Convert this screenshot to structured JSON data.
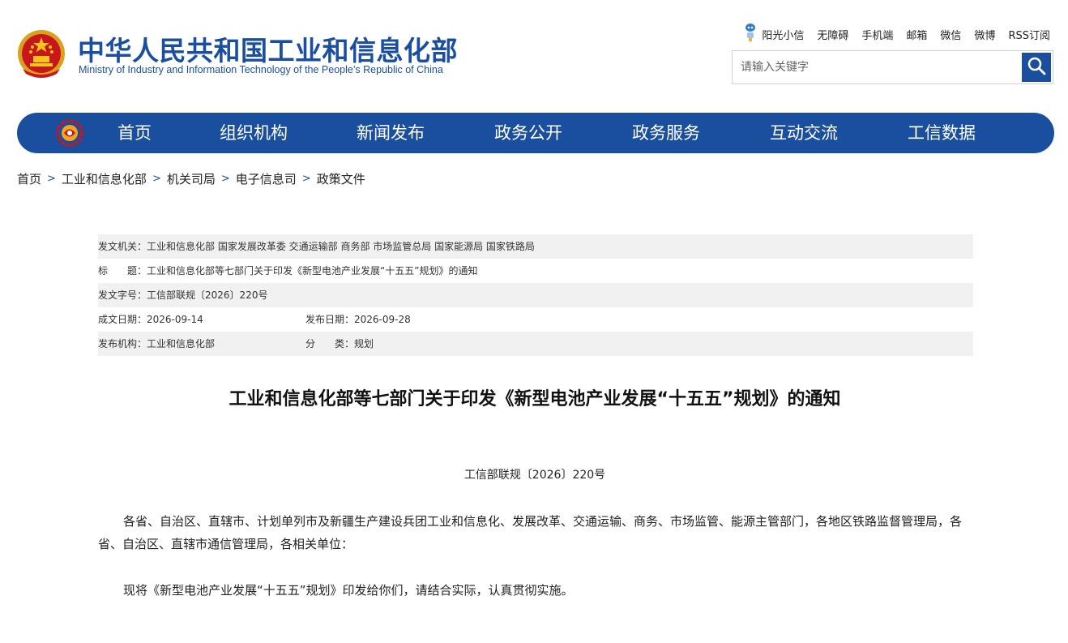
{
  "header": {
    "title": "中华人民共和国工业和信息化部",
    "subtitle": "Ministry of Industry and Information Technology of the People’s Republic of China",
    "emblem_icon": "national-emblem-icon",
    "brand_color": "#1a4f9f",
    "accent_red": "#c8161d"
  },
  "toplinks": {
    "assistant": "阳光小信",
    "accessibility": "无障碍",
    "mobile": "手机端",
    "mail": "邮箱",
    "wechat": "微信",
    "weibo": "微博",
    "rss": "RSS订阅"
  },
  "search": {
    "placeholder": "请输入关键字",
    "icon": "search-icon"
  },
  "nav": {
    "logo_icon": "miit-gear-logo-icon",
    "items": [
      "首页",
      "组织机构",
      "新闻发布",
      "政务公开",
      "政务服务",
      "互动交流",
      "工信数据"
    ]
  },
  "breadcrumb": [
    "首页",
    "工业和信息化部",
    "机关司局",
    "电子信息司",
    "政策文件"
  ],
  "meta": {
    "issuer_label": "发文机关：",
    "issuer": "工业和信息化部 国家发展改革委 交通运输部 商务部 市场监管总局 国家能源局 国家铁路局",
    "title_label": "标　　题：",
    "title": "工业和信息化部等七部门关于印发《新型电池产业发展“十五五”规划》的通知",
    "docno_label": "发文字号：",
    "docno": "工信部联规〔2026〕220号",
    "written_label": "成文日期：",
    "written": "2026-09-14",
    "published_label": "发布日期：",
    "published": "2026-09-28",
    "agency_label": "发布机构：",
    "agency": "工业和信息化部",
    "category_label": "分　　类：",
    "category": "规划"
  },
  "article": {
    "title": "工业和信息化部等七部门关于印发《新型电池产业发展“十五五”规划》的通知",
    "doc_number": "工信部联规〔2026〕220号",
    "para1": "各省、自治区、直辖市、计划单列市及新疆生产建设兵团工业和信息化、发展改革、交通运输、商务、市场监管、能源主管部门，各地区铁路监督管理局，各省、自治区、直辖市通信管理局，各相关单位：",
    "para2": "现将《新型电池产业发展“十五五”规划》印发给你们，请结合实际，认真贯彻实施。"
  }
}
